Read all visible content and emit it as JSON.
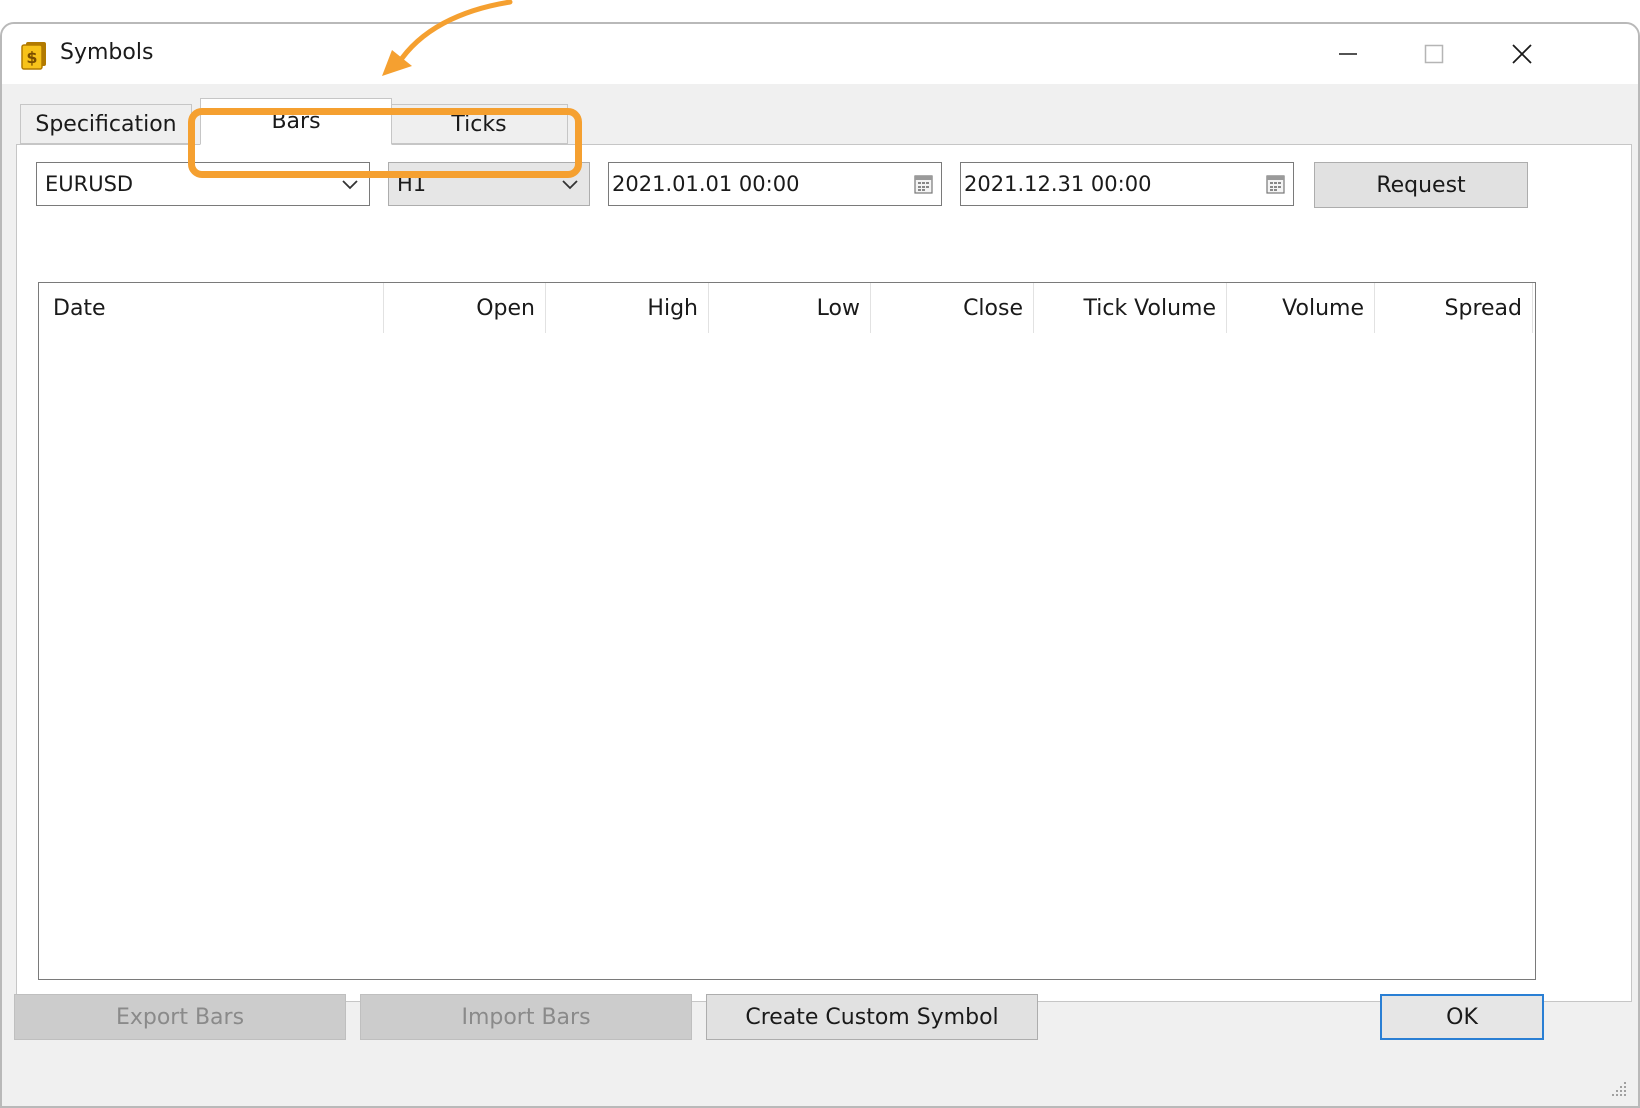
{
  "window": {
    "title": "Symbols"
  },
  "tabs": [
    {
      "label": "Specification",
      "active": false
    },
    {
      "label": "Bars",
      "active": true
    },
    {
      "label": "Ticks",
      "active": false
    }
  ],
  "toolbar": {
    "symbol": "EURUSD",
    "timeframe": "H1",
    "date_from": "2021.01.01 00:00",
    "date_to": "2021.12.31 00:00",
    "request_label": "Request"
  },
  "table": {
    "columns": [
      "Date",
      "Open",
      "High",
      "Low",
      "Close",
      "Tick Volume",
      "Volume",
      "Spread"
    ],
    "rows": []
  },
  "footer": {
    "export_label": "Export Bars",
    "import_label": "Import Bars",
    "create_label": "Create Custom Symbol",
    "ok_label": "OK"
  },
  "colors": {
    "highlight": "#f5a030",
    "default_button_border": "#2a7fd4",
    "icon_yellow": "#f7c21a"
  }
}
